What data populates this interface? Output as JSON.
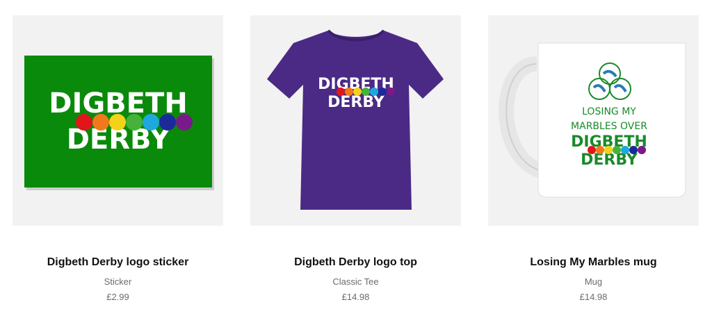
{
  "products": [
    {
      "title": "Digbeth Derby logo sticker",
      "subtitle": "Sticker",
      "price": "£2.99",
      "logo": {
        "line1": "DIGBETH",
        "line2": "DERBY"
      },
      "colors": {
        "background": "#0a8a0a",
        "text": "#ffffff"
      }
    },
    {
      "title": "Digbeth Derby logo top",
      "subtitle": "Classic Tee",
      "price": "£14.98",
      "logo": {
        "line1": "DIGBETH",
        "line2": "DERBY"
      },
      "colors": {
        "shirt": "#4b2a86",
        "text": "#ffffff"
      }
    },
    {
      "title": "Losing My Marbles mug",
      "subtitle": "Mug",
      "price": "£14.98",
      "logo": {
        "tagline1": "LOSING MY",
        "tagline2": "MARBLES OVER",
        "line1": "DIGBETH",
        "line2": "DERBY"
      },
      "colors": {
        "mug": "#ffffff",
        "text": "#1a8a2a"
      }
    }
  ],
  "marble_colors": [
    "#e0161b",
    "#f07a1a",
    "#f5d21a",
    "#46b23a",
    "#1ea8e0",
    "#1a2a9a",
    "#7a1a8a"
  ]
}
